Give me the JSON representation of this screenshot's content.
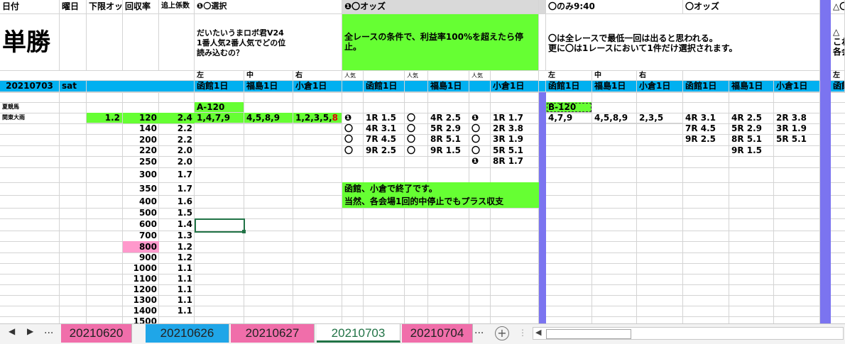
{
  "header": {
    "date": "日付",
    "weekday": "曜日",
    "lower_odds": "下限オッ",
    "recovery": "回収率",
    "bet_multiplier": "追上係数",
    "g1_title": "❶〇選択",
    "g2_title": "❶〇オッズ",
    "g3_title": "〇のみ9:40",
    "g4_title": "〇オッズ",
    "g5_title": "△〇"
  },
  "title_big": "単勝",
  "notes": {
    "n1": [
      "だいたいうまロボ君V24",
      "1番人気2番人気でどの位",
      "読み込むの？"
    ],
    "n2": [
      "全レースの条件で、利益率100%を超えたら停",
      "止。"
    ],
    "n3": [
      "〇は全レースで最低一回は出ると思われる。",
      "更に〇は1レースにおいて1件だけ選択されます。"
    ],
    "n4": [
      "△",
      "これ",
      "各会"
    ]
  },
  "pos": {
    "left": "左",
    "mid": "中",
    "right": "右",
    "ninki": "人気"
  },
  "date_row": {
    "date": "20210703",
    "day": "sat"
  },
  "venues": {
    "hakodate": "函館1日",
    "fukushima": "福島1日",
    "kokura": "小倉1日",
    "partial": "函館"
  },
  "race_labels": {
    "row1": "夏競馬",
    "row2": "関東大雨"
  },
  "lower_odds_value": "1.2",
  "recovery_list": [
    "120",
    "140",
    "200",
    "220",
    "250",
    "300",
    "350",
    "400",
    "500",
    "600",
    "700",
    "800",
    "900",
    "1000",
    "1100",
    "1200",
    "1300",
    "1400",
    "1500"
  ],
  "multiplier_list": [
    "2.4",
    "2.2",
    "2.2",
    "2.0",
    "2.0",
    "1.7",
    "1.7",
    "1.6",
    "1.5",
    "1.4",
    "1.3",
    "1.2",
    "1.2",
    "1.1",
    "1.1",
    "1.1",
    "1.1",
    "1.1",
    ""
  ],
  "selA": {
    "label": "A-120",
    "left": "1,4,7,9",
    "mid": "4,5,8,9",
    "right_prefix": "1,2,3,5,",
    "right_red": "8"
  },
  "odds_rows": [
    {
      "m1": "❶",
      "h": "1R 1.5",
      "m2": "〇",
      "f": "4R 2.5",
      "m3": "❶",
      "k": "1R 1.7"
    },
    {
      "m1": "〇",
      "h": "4R 3.1",
      "m2": "〇",
      "f": "5R 2.9",
      "m3": "〇",
      "k": "2R 3.8"
    },
    {
      "m1": "〇",
      "h": "7R 4.5",
      "m2": "〇",
      "f": "8R 5.1",
      "m3": "〇",
      "k": "3R 1.9"
    },
    {
      "m1": "〇",
      "h": "9R 2.5",
      "m2": "〇",
      "f": "9R 1.5",
      "m3": "〇",
      "k": "5R 5.1"
    },
    {
      "m1": "",
      "h": "",
      "m2": "",
      "f": "",
      "m3": "❶",
      "k": "8R 1.7"
    }
  ],
  "green_notes": [
    "函館、小倉で終了です。",
    "当然、各会場1回的中停止でもプラス収支"
  ],
  "selB": {
    "label": "B-120",
    "left": "4,7,9",
    "mid": "4,5,8,9",
    "right": "2,3,5"
  },
  "odds2": {
    "h": [
      "4R 3.1",
      "7R 4.5",
      "9R 2.5"
    ],
    "f": [
      "4R 2.5",
      "5R 2.9",
      "8R 5.1",
      "9R 1.5"
    ],
    "k": [
      "2R 3.8",
      "3R 1.9",
      "5R 5.1"
    ]
  },
  "tabs": {
    "dots": "...",
    "active": "20210703",
    "items": [
      {
        "label": "20210620",
        "color": "#f06eaa"
      },
      {
        "label": "20210626",
        "color": "#1fa6e8"
      },
      {
        "label": "20210627",
        "color": "#f06eaa"
      },
      {
        "label": "20210703",
        "color": "#ffffff"
      },
      {
        "label": "20210704",
        "color": "#f06eaa"
      }
    ],
    "more": "...",
    "add": "+"
  }
}
